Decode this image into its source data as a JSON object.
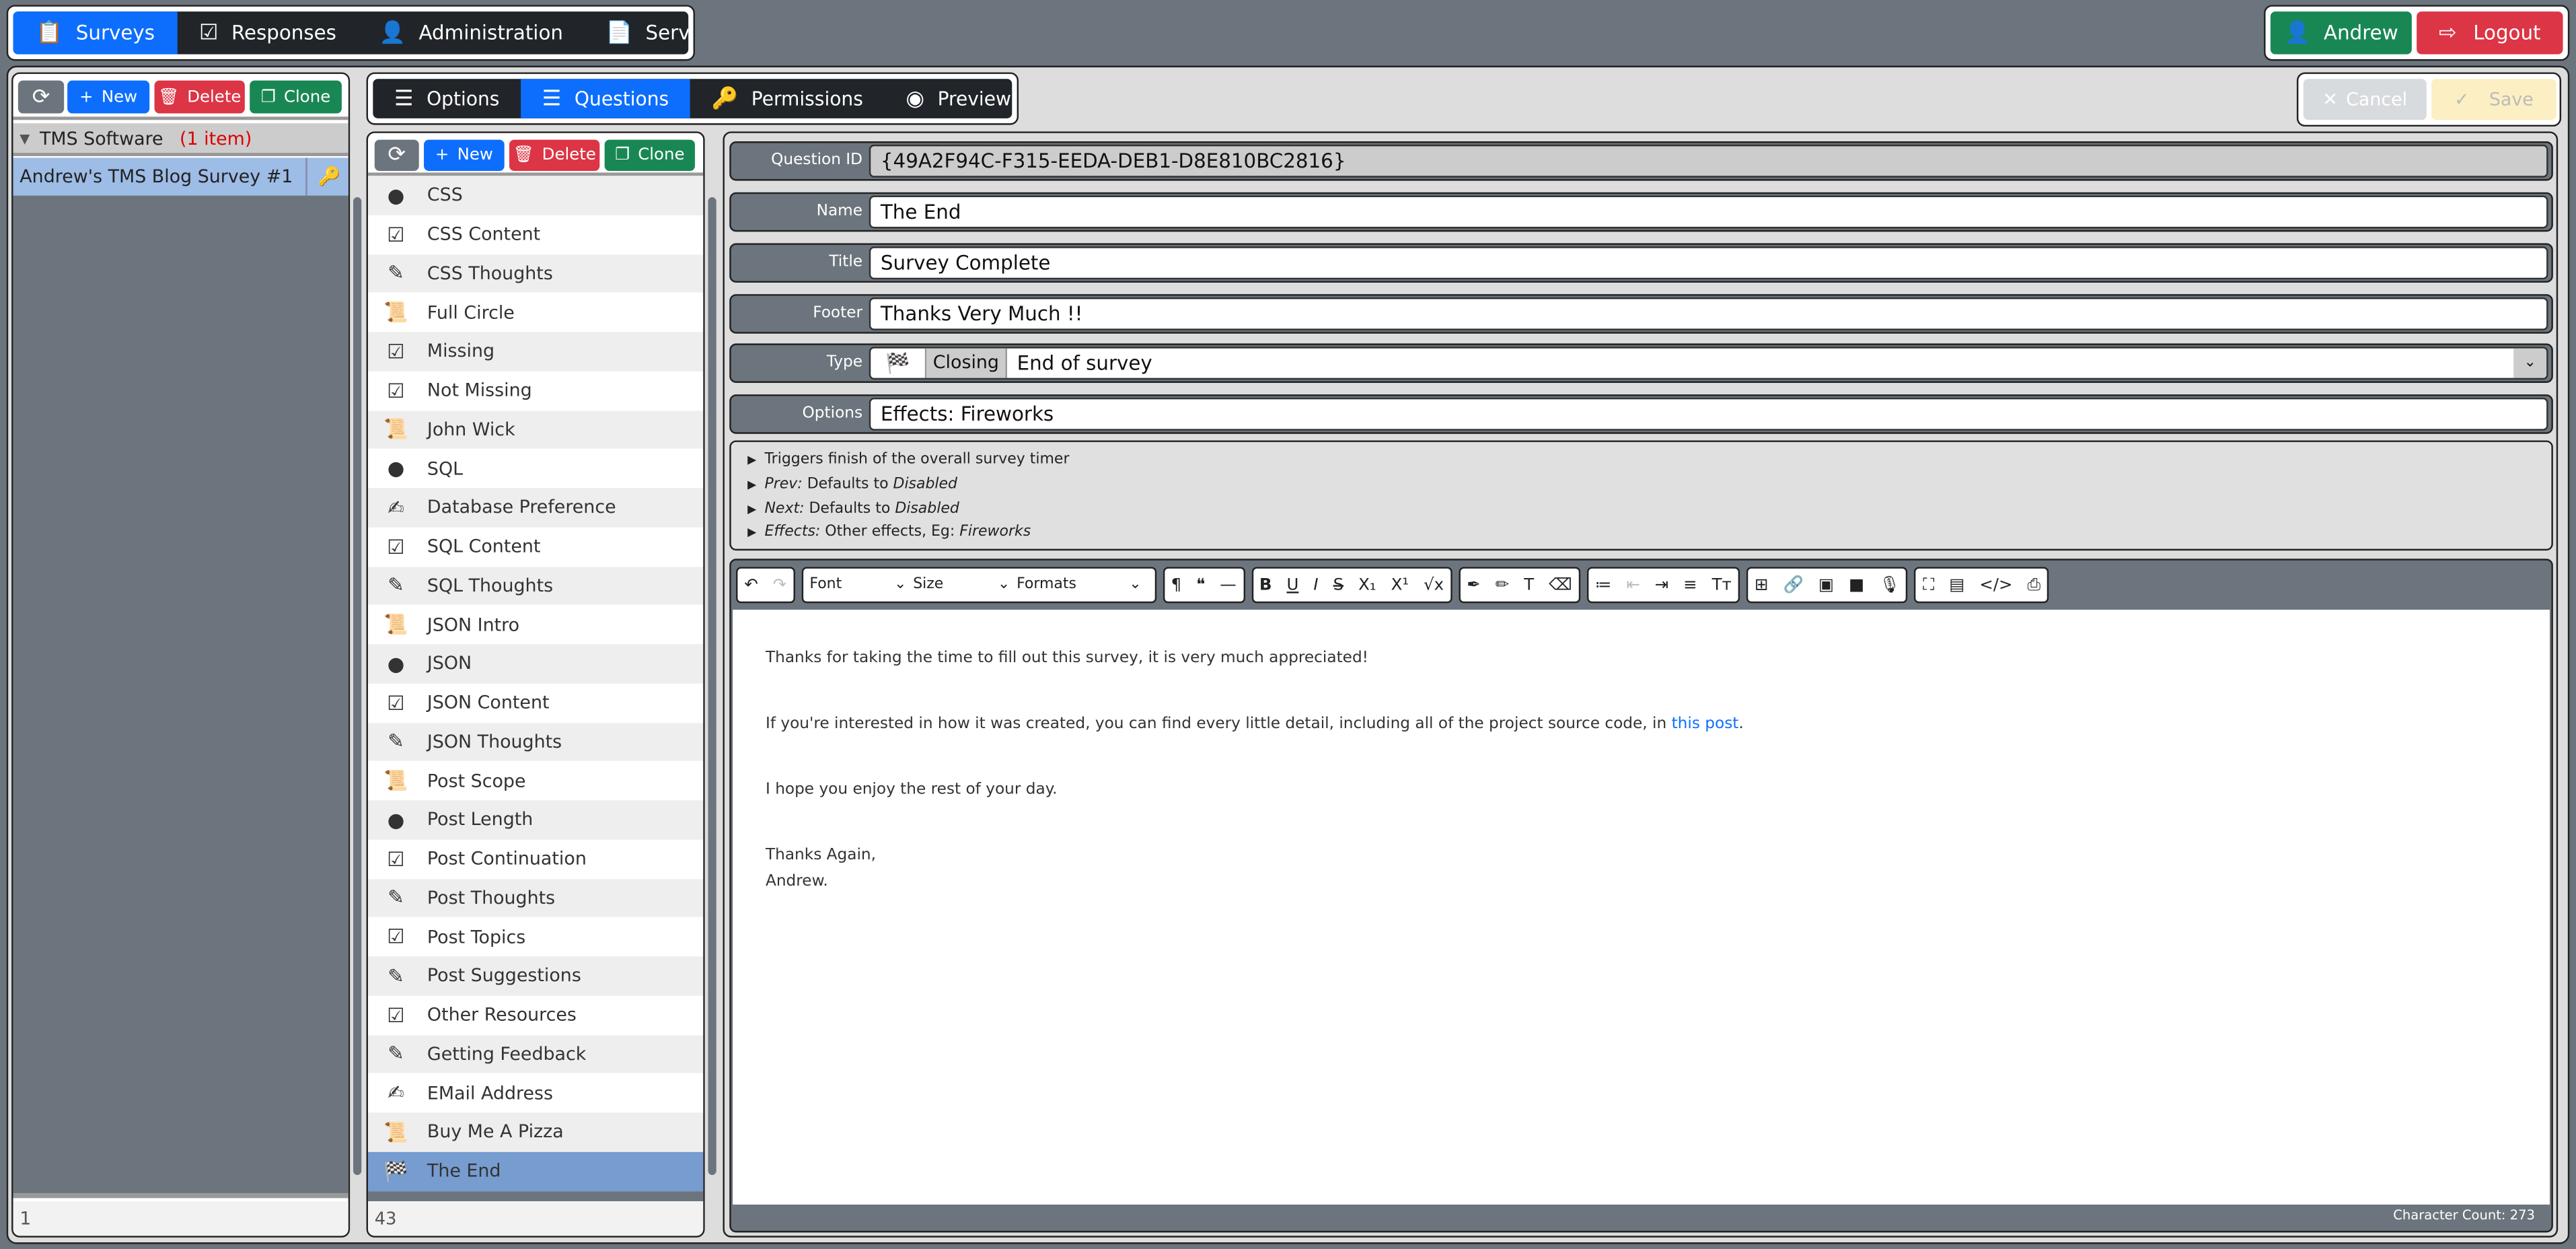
{
  "topnav": {
    "items": [
      {
        "label": "Surveys",
        "icon": "clipboard-list-icon",
        "active": true
      },
      {
        "label": "Responses",
        "icon": "clipboard-check-icon"
      },
      {
        "label": "Administration",
        "icon": "clipboard-user-icon"
      },
      {
        "label": "Server Log",
        "icon": "clipboard-icon"
      }
    ],
    "user": "Andrew",
    "logout": "Logout"
  },
  "colors": {
    "primary": "#0d6efd",
    "success": "#198754",
    "danger": "#dc3545",
    "dark": "#212529",
    "secondary": "#6c757d",
    "selected": "#769cd0"
  },
  "surveys": {
    "toolbar": {
      "new": "New",
      "delete": "Delete",
      "clone": "Clone"
    },
    "group": "TMS Software",
    "group_count": "(1 item)",
    "items": [
      "Andrew's TMS Blog Survey #1"
    ],
    "footer": "1"
  },
  "tabs": [
    {
      "label": "Options",
      "icon": "list-check-icon"
    },
    {
      "label": "Questions",
      "icon": "list-ol-icon",
      "active": true
    },
    {
      "label": "Permissions",
      "icon": "key-icon"
    },
    {
      "label": "Preview",
      "icon": "eye-icon"
    }
  ],
  "actions": {
    "cancel": "Cancel",
    "save": "Save"
  },
  "questions": {
    "toolbar": {
      "new": "New",
      "delete": "Delete",
      "clone": "Clone"
    },
    "footer": "43",
    "items": [
      {
        "label": "CSS",
        "icon": "check-circle"
      },
      {
        "label": "CSS Content",
        "icon": "check-square"
      },
      {
        "label": "CSS Thoughts",
        "icon": "pencil"
      },
      {
        "label": "Full Circle",
        "icon": "scroll"
      },
      {
        "label": "Missing",
        "icon": "check-square"
      },
      {
        "label": "Not Missing",
        "icon": "check-square"
      },
      {
        "label": "John Wick",
        "icon": "scroll"
      },
      {
        "label": "SQL",
        "icon": "check-circle"
      },
      {
        "label": "Database Preference",
        "icon": "pen-square"
      },
      {
        "label": "SQL Content",
        "icon": "check-square"
      },
      {
        "label": "SQL Thoughts",
        "icon": "pencil"
      },
      {
        "label": "JSON Intro",
        "icon": "scroll"
      },
      {
        "label": "JSON",
        "icon": "check-circle"
      },
      {
        "label": "JSON Content",
        "icon": "check-square"
      },
      {
        "label": "JSON Thoughts",
        "icon": "pencil"
      },
      {
        "label": "Post Scope",
        "icon": "scroll"
      },
      {
        "label": "Post Length",
        "icon": "check-circle"
      },
      {
        "label": "Post Continuation",
        "icon": "check-square"
      },
      {
        "label": "Post Thoughts",
        "icon": "pencil"
      },
      {
        "label": "Post Topics",
        "icon": "check-square"
      },
      {
        "label": "Post Suggestions",
        "icon": "pencil"
      },
      {
        "label": "Other Resources",
        "icon": "check-square"
      },
      {
        "label": "Getting Feedback",
        "icon": "pencil"
      },
      {
        "label": "EMail Address",
        "icon": "pen-square"
      },
      {
        "label": "Buy Me A Pizza",
        "icon": "scroll"
      },
      {
        "label": "The End",
        "icon": "flag-checkered",
        "selected": true
      }
    ]
  },
  "form": {
    "fields": [
      {
        "label": "Question ID",
        "value": "{49A2F94C-F315-EEDA-DEB1-D8E810BC2816}",
        "readonly": true
      },
      {
        "label": "Name",
        "value": "The End"
      },
      {
        "label": "Title",
        "value": "Survey Complete"
      },
      {
        "label": "Footer",
        "value": "Thanks Very Much !!"
      }
    ],
    "type": {
      "label": "Type",
      "category": "Closing",
      "value": "End of survey"
    },
    "options": {
      "label": "Options",
      "value": "Effects: Fireworks"
    },
    "help": [
      {
        "pre": "",
        "text": "Triggers finish of the overall survey timer",
        "post": ""
      },
      {
        "pre": "Prev:",
        "text": " Defaults to ",
        "post": "Disabled"
      },
      {
        "pre": "Next:",
        "text": " Defaults to ",
        "post": "Disabled"
      },
      {
        "pre": "Effects:",
        "text": " Other effects, Eg: ",
        "post": "Fireworks"
      }
    ]
  },
  "editor": {
    "font": "Font",
    "size": "Size",
    "formats": "Formats",
    "content": {
      "p1": "Thanks for taking the time to fill out this survey, it is very much appreciated!",
      "p2": "If you're interested in how it was created, you can find every little detail, including all of the project source code, in ",
      "link": "this post",
      "p2_end": ".",
      "p3": "I hope you enjoy the rest of your day.",
      "p4a": "Thanks Again,",
      "p4b": "Andrew."
    },
    "char_count": "Character Count: 273"
  }
}
